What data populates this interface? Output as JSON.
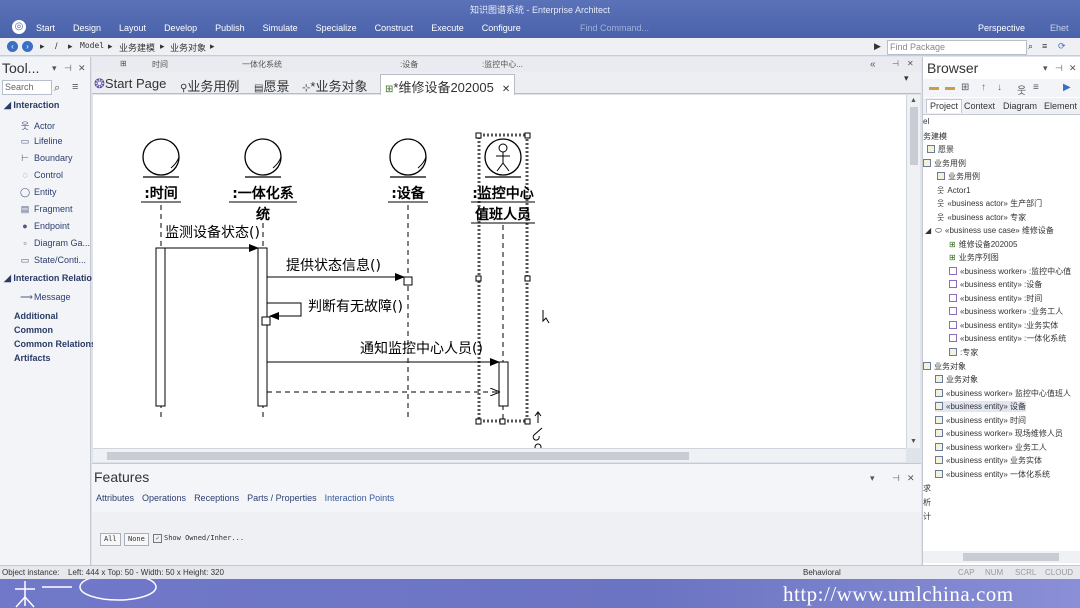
{
  "window": {
    "title": "知识图谱系统 - Enterprise Architect",
    "menu": [
      "Start",
      "Design",
      "Layout",
      "Develop",
      "Publish",
      "Simulate",
      "Specialize",
      "Construct",
      "Execute",
      "Configure"
    ],
    "find_command": "Find Command...",
    "perspective": "Perspective",
    "user": "Ehet"
  },
  "navbar": {
    "path_root": "/",
    "crumbs": [
      "Model",
      "业务建模",
      "业务对象"
    ],
    "find_package_placeholder": "Find Package"
  },
  "toolbox": {
    "title": "Tool...",
    "search_placeholder": "Search",
    "sections": {
      "interaction": "Interaction",
      "interaction_relations": "Interaction Relatio",
      "additional": "Additional",
      "common": "Common",
      "common_relations": "Common Relations",
      "artifacts": "Artifacts"
    },
    "interaction_items": [
      "Actor",
      "Lifeline",
      "Boundary",
      "Control",
      "Entity",
      "Fragment",
      "Endpoint",
      "Diagram Ga...",
      "State/Conti..."
    ],
    "relation_items": [
      "Message"
    ]
  },
  "dockstrip": [
    "时间",
    "一体化系统",
    ":设备",
    ":监控中心..."
  ],
  "tabs": [
    "Start Page",
    "业务用例",
    "愿景",
    "*业务对象",
    "*维修设备202005"
  ],
  "diagram": {
    "lifelines": [
      ":时间",
      ":一体化系",
      "统",
      ":设备",
      ":监控中心",
      "值班人员"
    ],
    "messages": [
      "监测设备状态()",
      "提供状态信息()",
      "判断有无故障()",
      "通知监控中心人员()"
    ]
  },
  "features": {
    "title": "Features",
    "tabs": [
      "Attributes",
      "Operations",
      "Receptions",
      "Parts / Properties",
      "Interaction Points"
    ],
    "btn_all": "All",
    "btn_none": "None",
    "show_owned": "Show Owned/Inher..."
  },
  "browser": {
    "title": "Browser",
    "tabs": [
      "Project",
      "Context",
      "Diagram",
      "Element"
    ],
    "tree": [
      "el",
      "务建模",
      "愿景",
      "业务用例",
      "业务用例",
      "Actor1",
      "«business actor» 生产部门",
      "«business actor» 专家",
      "«business use case» 维修设备",
      "维修设备202005",
      "业务序列图",
      "«business worker» :监控中心值",
      "«business entity» :设备",
      "«business entity» :时间",
      "«business worker» :业务工人",
      "«business entity» :业务实体",
      "«business entity» :一体化系统",
      ":专家",
      "业务对象",
      "业务对象",
      "«business worker» 监控中心值班人",
      "«business entity» 设备",
      "«business entity» 时间",
      "«business worker» 现场维修人员",
      "«business worker» 业务工人",
      "«business entity» 业务实体",
      "«business entity» 一体化系统",
      "求",
      "析",
      "计"
    ]
  },
  "status": {
    "object": "Object instance:",
    "left": "Left:   444 x Top:   50 - Width:   50 x Height:   320",
    "mode": "Behavioral",
    "caps": "CAP",
    "num": "NUM",
    "scrl": "SCRL",
    "cloud": "CLOUD"
  },
  "watermark": "http://www.umlchina.com"
}
